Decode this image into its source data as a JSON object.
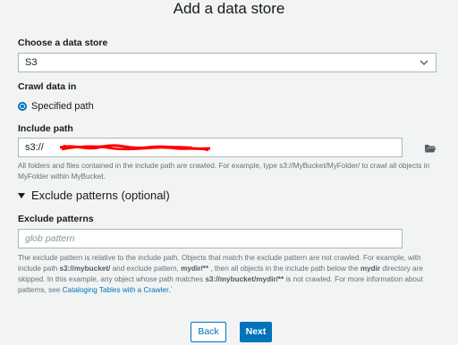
{
  "page": {
    "title": "Add a data store"
  },
  "data_store": {
    "label": "Choose a data store",
    "selected": "S3"
  },
  "crawl": {
    "label": "Crawl data in",
    "option": "Specified path"
  },
  "include_path": {
    "label": "Include path",
    "value_prefix": "s3://",
    "help": "All folders and files contained in the include path are crawled. For example, type s3://MyBucket/MyFolder/ to crawl all objects in MyFolder within MyBucket."
  },
  "exclude": {
    "section_title": "Exclude patterns (optional)",
    "label": "Exclude patterns",
    "placeholder": "glob pattern",
    "help": {
      "p1": "The exclude pattern is relative to the include path. Objects that match the exclude pattern are not crawled. For example, with include path ",
      "b1": "s3://mybucket/",
      "p2": " and exclude pattern, ",
      "b2": "mydir/**",
      "p3": " , then all objects in the include path below the ",
      "b3": "mydir",
      "p4": " directory are skipped. In this example, any object whose path matches ",
      "b4": "s3://mybucket/mydir/**",
      "p5": " is not crawled. For more information about patterns, see ",
      "link": "Cataloging Tables with a Crawler.",
      "link_suffix": "´"
    }
  },
  "buttons": {
    "back": "Back",
    "next": "Next"
  },
  "colors": {
    "accent": "#0073bb",
    "redaction": "#ff0000",
    "background": "#f2f3f3"
  },
  "icons": {
    "dropdown": "chevron-down-icon",
    "browse": "folder-icon",
    "expand": "caret-down-icon"
  }
}
